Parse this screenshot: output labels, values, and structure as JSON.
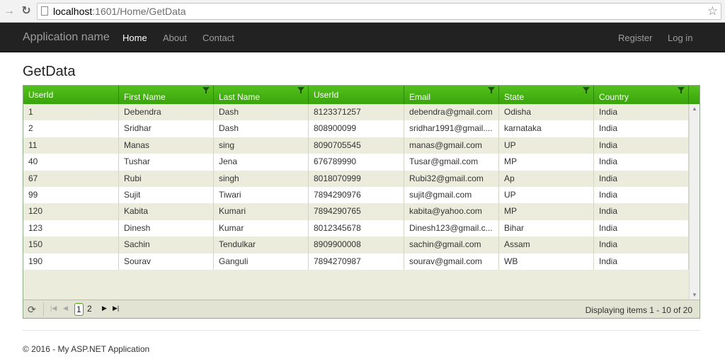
{
  "browser": {
    "url_host": "localhost",
    "url_path": ":1601/Home/GetData"
  },
  "navbar": {
    "brand": "Application name",
    "links": [
      "Home",
      "About",
      "Contact"
    ],
    "right_links": [
      "Register",
      "Log in"
    ]
  },
  "page": {
    "title": "GetData"
  },
  "grid": {
    "columns": [
      "UserId",
      "First Name",
      "Last Name",
      "UserId",
      "Email",
      "State",
      "Country"
    ],
    "rows": [
      [
        "1",
        "Debendra",
        "Dash",
        "8123371257",
        "debendra@gmail.com",
        "Odisha",
        "India"
      ],
      [
        "2",
        "Sridhar",
        "Dash",
        "808900099",
        "sridhar1991@gmail....",
        "karnataka",
        "India"
      ],
      [
        "11",
        "Manas",
        "sing",
        "8090705545",
        "manas@gmail.com",
        "UP",
        "India"
      ],
      [
        "40",
        "Tushar",
        "Jena",
        "676789990",
        "Tusar@gmail.com",
        "MP",
        "India"
      ],
      [
        "67",
        "Rubi",
        "singh",
        "8018070999",
        "Rubi32@gmail.com",
        "Ap",
        "India"
      ],
      [
        "99",
        "Sujit",
        "Tiwari",
        "7894290976",
        "sujit@gmail.com",
        "UP",
        "India"
      ],
      [
        "120",
        "Kabita",
        "Kumari",
        "7894290765",
        "kabita@yahoo.com",
        "MP",
        "India"
      ],
      [
        "123",
        "Dinesh",
        "Kumar",
        "8012345678",
        "Dinesh123@gmail.c...",
        "Bihar",
        "India"
      ],
      [
        "150",
        "Sachin",
        "Tendulkar",
        "8909900008",
        "sachin@gmail.com",
        "Assam",
        "India"
      ],
      [
        "190",
        "Sourav",
        "Ganguli",
        "7894270987",
        "sourav@gmail.com",
        "WB",
        "India"
      ]
    ]
  },
  "pager": {
    "pages": [
      "1",
      "2"
    ],
    "current_page": "1",
    "info": "Displaying items 1 - 10 of 20"
  },
  "footer": {
    "text": "© 2016 - My ASP.NET Application"
  },
  "colors": {
    "header_green": "#3aa30d",
    "navbar": "#222222",
    "row_alt": "#ececdc"
  }
}
